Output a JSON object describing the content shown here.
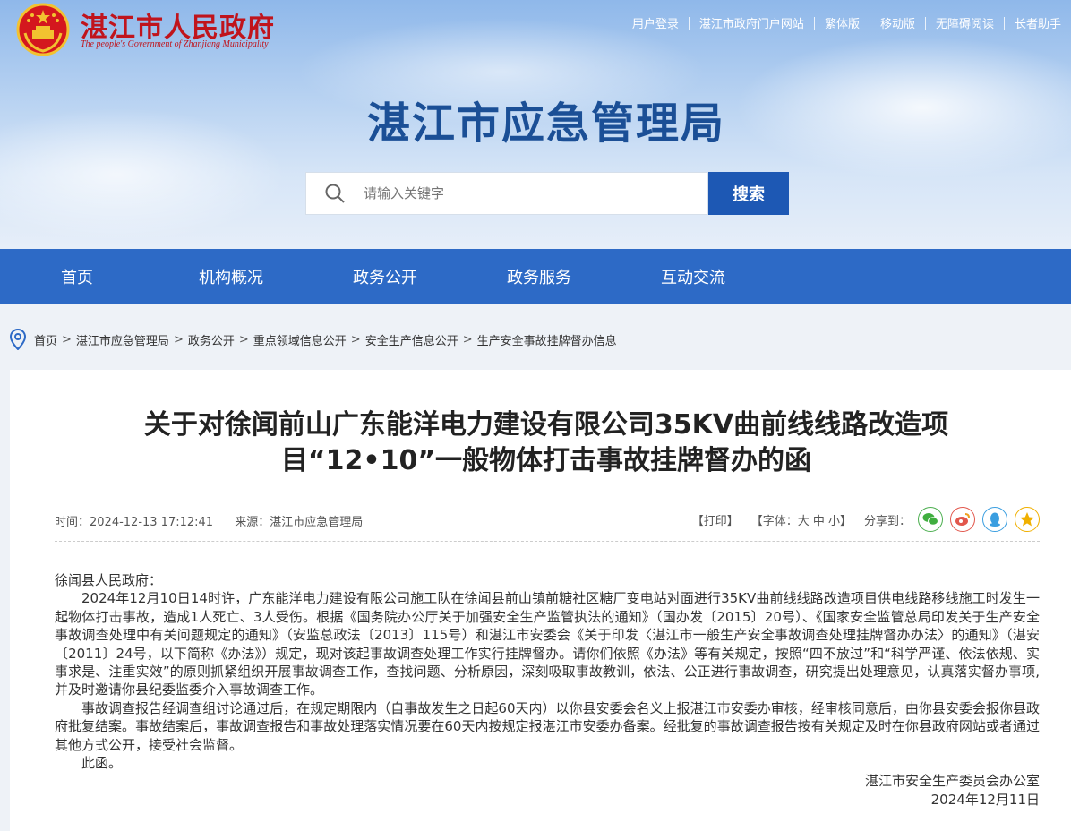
{
  "gov": {
    "name": "湛江市人民政府",
    "name_en": "The people's Government of Zhanjiang Municipality"
  },
  "toplinks": [
    "用户登录",
    "湛江市政府门户网站",
    "繁体版",
    "移动版",
    "无障碍阅读",
    "长者助手"
  ],
  "site_title": "湛江市应急管理局",
  "search": {
    "placeholder": "请输入关键字",
    "button": "搜索"
  },
  "nav": [
    "首页",
    "机构概况",
    "政务公开",
    "政务服务",
    "互动交流"
  ],
  "breadcrumb": [
    "首页",
    "湛江市应急管理局",
    "政务公开",
    "重点领域信息公开",
    "安全生产信息公开",
    "生产安全事故挂牌督办信息"
  ],
  "breadcrumb_sep": ">",
  "article": {
    "title_line1": "关于对徐闻前山广东能洋电力建设有限公司35KV曲前线线路改造项",
    "title_line2": "目“12•10”一般物体打击事故挂牌督办的函",
    "time": "时间：2024-12-13 17:12:41",
    "source": "来源：湛江市应急管理局",
    "print": "【打印】",
    "font_size": "【字体：大 中 小】",
    "share_label": "分享到：",
    "salutation": "徐闻县人民政府：",
    "para1": "2024年12月10日14时许，广东能洋电力建设有限公司施工队在徐闻县前山镇前糖社区糖厂变电站对面进行35KV曲前线线路改造项目供电线路移线施工时发生一起物体打击事故，造成1人死亡、3人受伤。根据《国务院办公厅关于加强安全生产监管执法的通知》（国办发〔2015〕20号）、《国家安全监管总局印发关于生产安全事故调查处理中有关问题规定的通知》（安监总政法〔2013〕115号）和湛江市安委会《关于印发〈湛江市一般生产安全事故调查处理挂牌督办办法〉的通知》（湛安〔2011〕24号，以下简称《办法》）规定，现对该起事故调查处理工作实行挂牌督办。请你们依照《办法》等有关规定，按照“四不放过”和“科学严谨、依法依规、实事求是、注重实效”的原则抓紧组织开展事故调查工作，查找问题、分析原因，深刻吸取事故教训，依法、公正进行事故调查，研究提出处理意见，认真落实督办事项,并及时邀请你县纪委监委介入事故调查工作。",
    "para2": "事故调查报告经调查组讨论通过后，在规定期限内（自事故发生之日起60天内）以你县安委会名义上报湛江市安委办审核，经审核同意后，由你县安委会报你县政府批复结案。事故结案后，事故调查报告和事故处理落实情况要在60天内按规定报湛江市安委办备案。经批复的事故调查报告按有关规定及时在你县政府网站或者通过其他方式公开，接受社会监督。",
    "closing": "此函。",
    "signature": "湛江市安全生产委员会办公室",
    "date": "2024年12月11日"
  },
  "colors": {
    "nav_bg": "#2d6ac6",
    "search_btn": "#1d58b4",
    "title_blue": "#1b4f96",
    "gov_red": "#c0141c"
  },
  "share_icons": [
    "wechat-icon",
    "weibo-icon",
    "qq-icon",
    "qzone-icon"
  ]
}
